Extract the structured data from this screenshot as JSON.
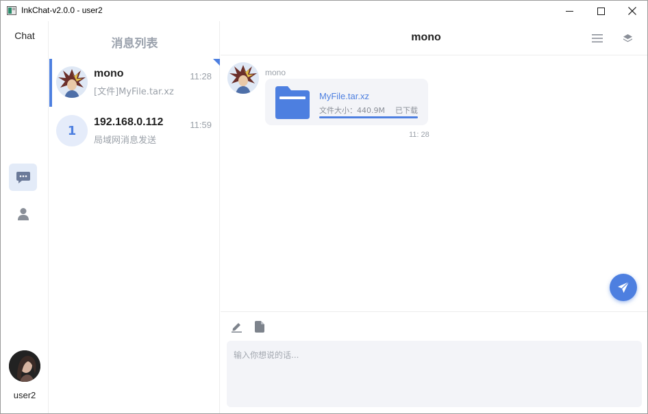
{
  "window": {
    "title": "InkChat-v2.0.0 - user2",
    "controls": [
      "minimize-icon",
      "maximize-icon",
      "close-icon"
    ]
  },
  "rail": {
    "brand": "Chat",
    "nav": [
      {
        "name": "chat",
        "icon": "chat-bubble-icon",
        "active": true
      },
      {
        "name": "contacts",
        "icon": "user-icon",
        "active": false
      }
    ],
    "username": "user2"
  },
  "conversation_list": {
    "title": "消息列表",
    "items": [
      {
        "name": "mono",
        "time": "11:28",
        "preview": "[文件]MyFile.tar.xz",
        "avatar": "anime-character-avatar",
        "selected": true
      },
      {
        "name": "192.168.0.112",
        "time": "11:59",
        "preview": "局域网消息发送",
        "avatar_text": "1",
        "selected": false
      }
    ]
  },
  "chat": {
    "title": "mono",
    "header_icons": [
      "menu-icon",
      "layers-icon"
    ],
    "messages": [
      {
        "sender": "mono",
        "type": "file",
        "file_name": "MyFile.tar.xz",
        "file_size": "文件大小：440.9M",
        "status": "已下载",
        "progress": 1.0,
        "time": "11: 28"
      }
    ],
    "composer": {
      "tools": [
        "edit-icon",
        "file-icon"
      ],
      "placeholder": "输入你想说的话..."
    },
    "send_icon": "send-icon"
  },
  "colors": {
    "accent": "#4d7fe0",
    "muted_text": "#9aa0a8",
    "bubble_bg": "#f3f4f8",
    "active_nav_bg": "#e3ebf8"
  }
}
